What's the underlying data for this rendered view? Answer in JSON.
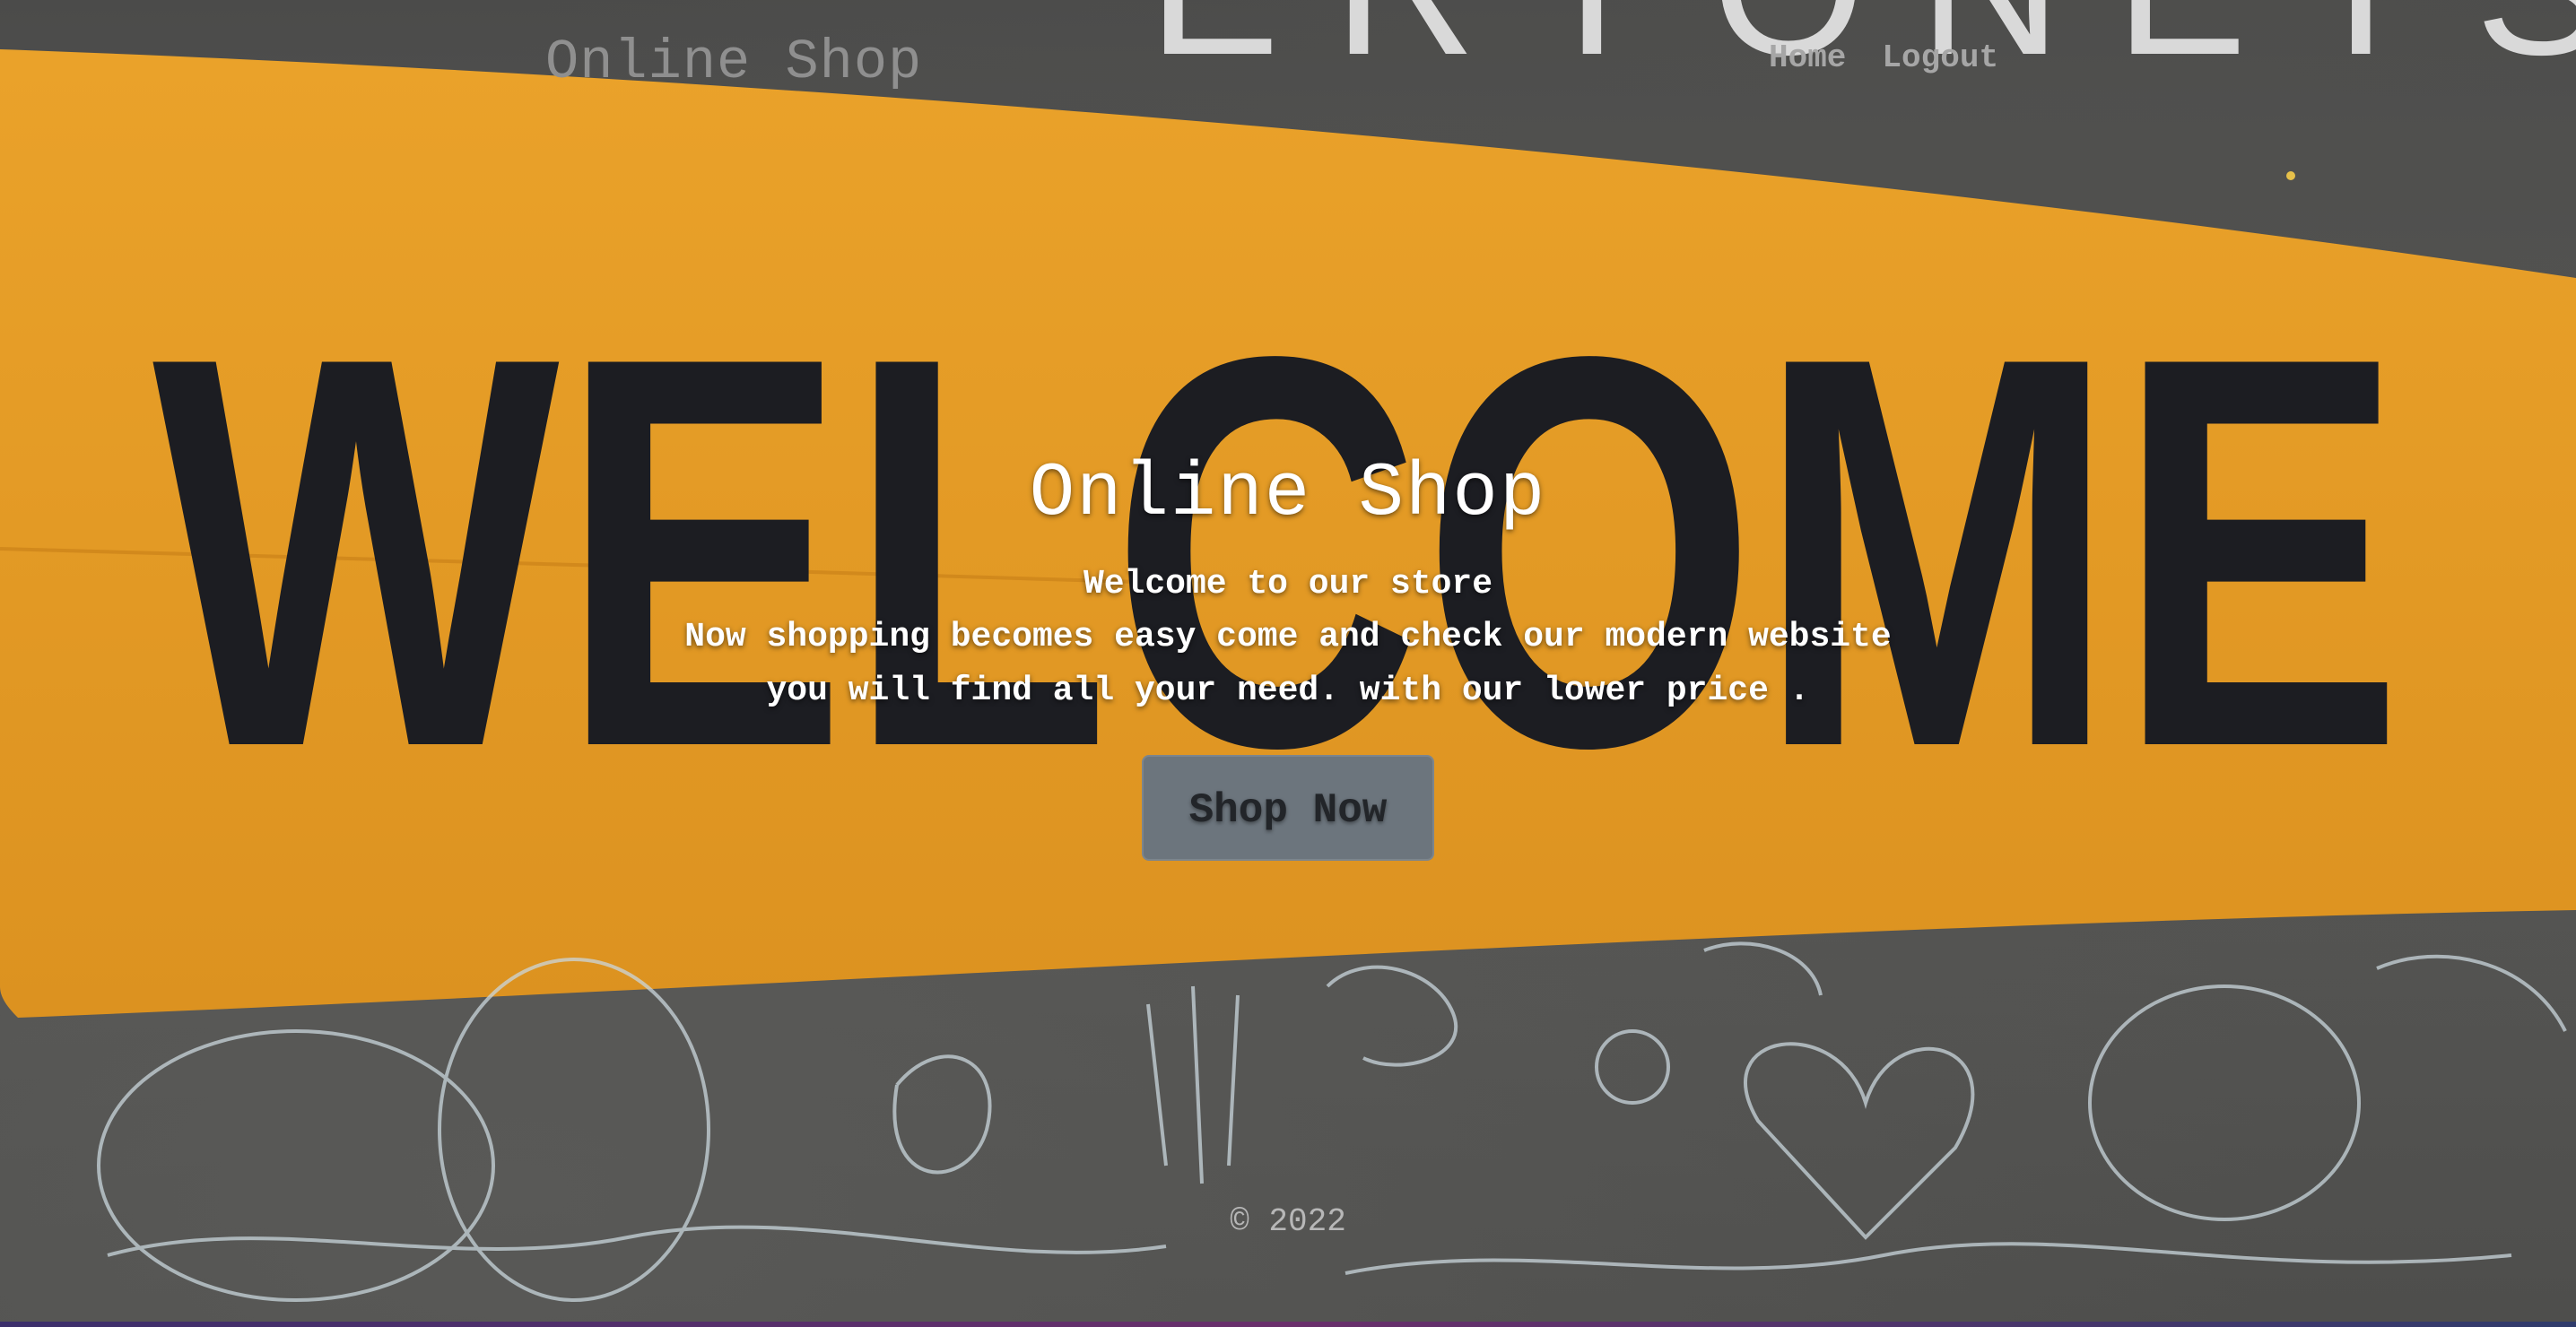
{
  "navbar": {
    "brand": "Online Shop",
    "links": [
      {
        "label": "Home"
      },
      {
        "label": "Logout"
      }
    ]
  },
  "hero": {
    "title": "Online Shop",
    "welcome": "Welcome to our store",
    "line1": "Now shopping becomes easy come and check our modern website",
    "line2": "you will find all your need. with our lower price .",
    "button_label": "Shop Now"
  },
  "background": {
    "banner_text": "WELCOME",
    "top_text": "ERYONETS",
    "colors": {
      "banner": "#e89b24",
      "letters": "#1c1d22",
      "wall": "#4f4f4d",
      "chalk": "#c9d6dc"
    }
  },
  "footer": {
    "copyright": "© 2022"
  },
  "colors": {
    "button_bg": "#6c757d",
    "button_text": "#222529",
    "nav_text": "#a6a6a6",
    "brand_text": "#8f8f8f"
  }
}
